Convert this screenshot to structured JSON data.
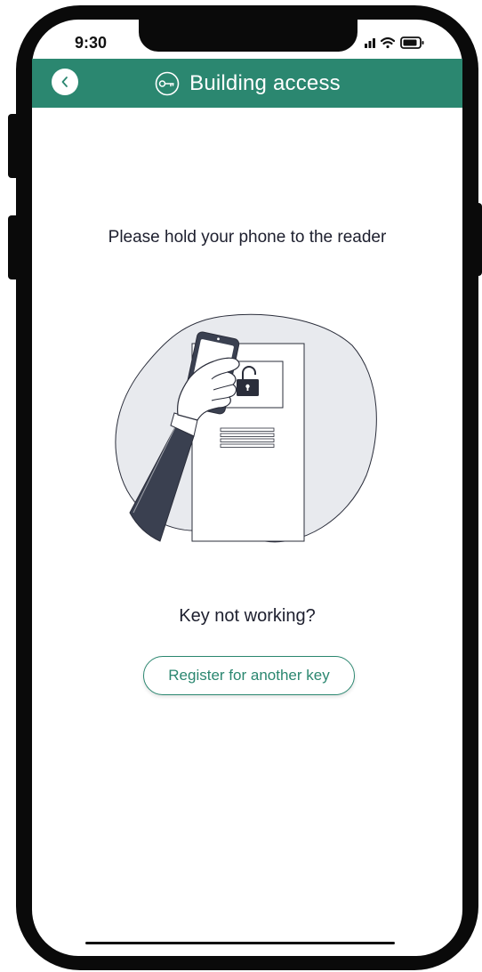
{
  "status_bar": {
    "time": "9:30"
  },
  "header": {
    "title": "Building access",
    "back_icon": "chevron-left-icon",
    "title_icon": "key-icon"
  },
  "main": {
    "instruction": "Please hold your phone to the reader",
    "illustration": "phone-to-reader-illustration",
    "help_question": "Key not working?",
    "register_button_label": "Register for another key"
  },
  "colors": {
    "brand": "#2b8770",
    "text": "#1d1f2e",
    "blob": "#e8eaee",
    "sleeve": "#3a4050"
  }
}
